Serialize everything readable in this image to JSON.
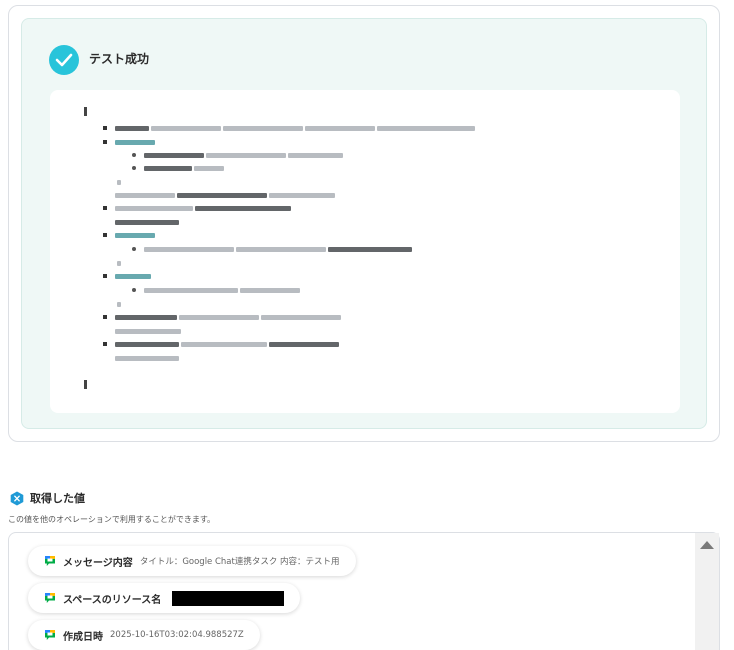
{
  "test_result": {
    "title": "テスト成功"
  },
  "acquired": {
    "title": "取得した値",
    "description": "この値を他のオペレーションで利用することができます。"
  },
  "values": [
    {
      "label": "メッセージ内容",
      "value": "タイトル：Google Chat連携タスク 内容：テスト用"
    },
    {
      "label": "スペースのリソース名",
      "value": ""
    },
    {
      "label": "作成日時",
      "value": "2025-10-16T03:02:04.988527Z"
    }
  ],
  "colors": {
    "check_badge": "#28c4da",
    "success_background": "#eff8f6",
    "redaction": "#000000"
  },
  "icons": [
    "check-icon",
    "hexagon-x-icon",
    "google-chat-icon",
    "scroll-up-icon"
  ]
}
